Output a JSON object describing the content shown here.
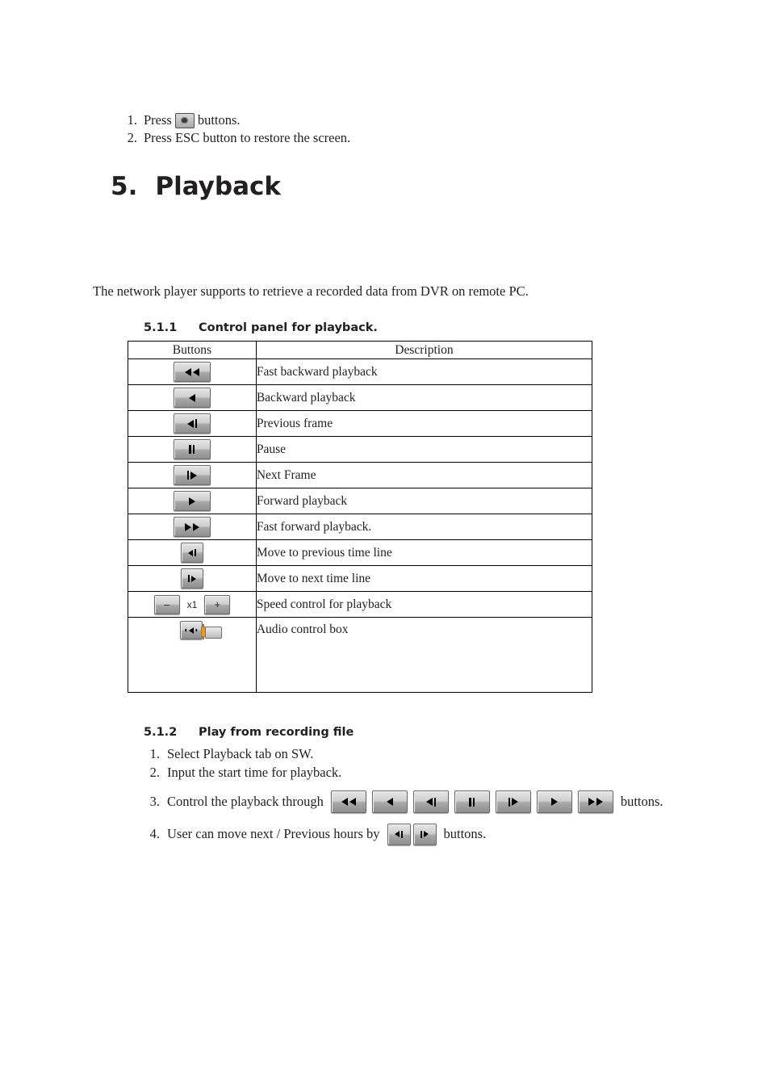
{
  "intro": {
    "items": [
      {
        "num": "1.",
        "before": "Press",
        "icon": "camera-icon",
        "after": "buttons."
      },
      {
        "num": "2.",
        "text": "Press ESC button to restore the screen."
      }
    ]
  },
  "heading": {
    "number": "5.",
    "title": "Playback"
  },
  "paragraph": "The network player supports to retrieve a recorded data from DVR on remote PC.",
  "section_511": {
    "number": "5.1.1",
    "title": "Control panel for playback."
  },
  "table": {
    "headers": [
      "Buttons",
      "Description"
    ],
    "rows": [
      {
        "icon": "fast-backward-icon",
        "description": "Fast backward playback"
      },
      {
        "icon": "backward-play-icon",
        "description": "Backward playback"
      },
      {
        "icon": "previous-frame-icon",
        "description": "Previous frame"
      },
      {
        "icon": "pause-icon",
        "description": "Pause"
      },
      {
        "icon": "next-frame-icon",
        "description": "Next Frame"
      },
      {
        "icon": "forward-play-icon",
        "description": "Forward playback"
      },
      {
        "icon": "fast-forward-icon",
        "description": "Fast forward playback."
      },
      {
        "icon": "previous-timeline-icon",
        "description": "Move to previous time line"
      },
      {
        "icon": "next-timeline-icon",
        "description": "Move to next time line"
      },
      {
        "icon": "speed-control-group",
        "description": "Speed control for playback"
      },
      {
        "icon": "audio-control-box",
        "description": "Audio control box"
      }
    ],
    "speed": {
      "minus_label": "–",
      "value_label": "x1",
      "plus_label": "+"
    }
  },
  "section_512": {
    "number": "5.1.2",
    "title": "Play from recording file"
  },
  "steps": [
    {
      "num": "1.",
      "text": "Select Playback tab on SW."
    },
    {
      "num": "2.",
      "text": "Input the start time for playback."
    },
    {
      "num": "3.",
      "before": "Control the playback through",
      "after": "buttons."
    },
    {
      "num": "4.",
      "before": "User can move next / Previous hours by",
      "after": "buttons."
    }
  ],
  "colors": {
    "text": "#231f20",
    "button_border": "#6b6b6b",
    "slider_accent": "#e59a2b"
  }
}
